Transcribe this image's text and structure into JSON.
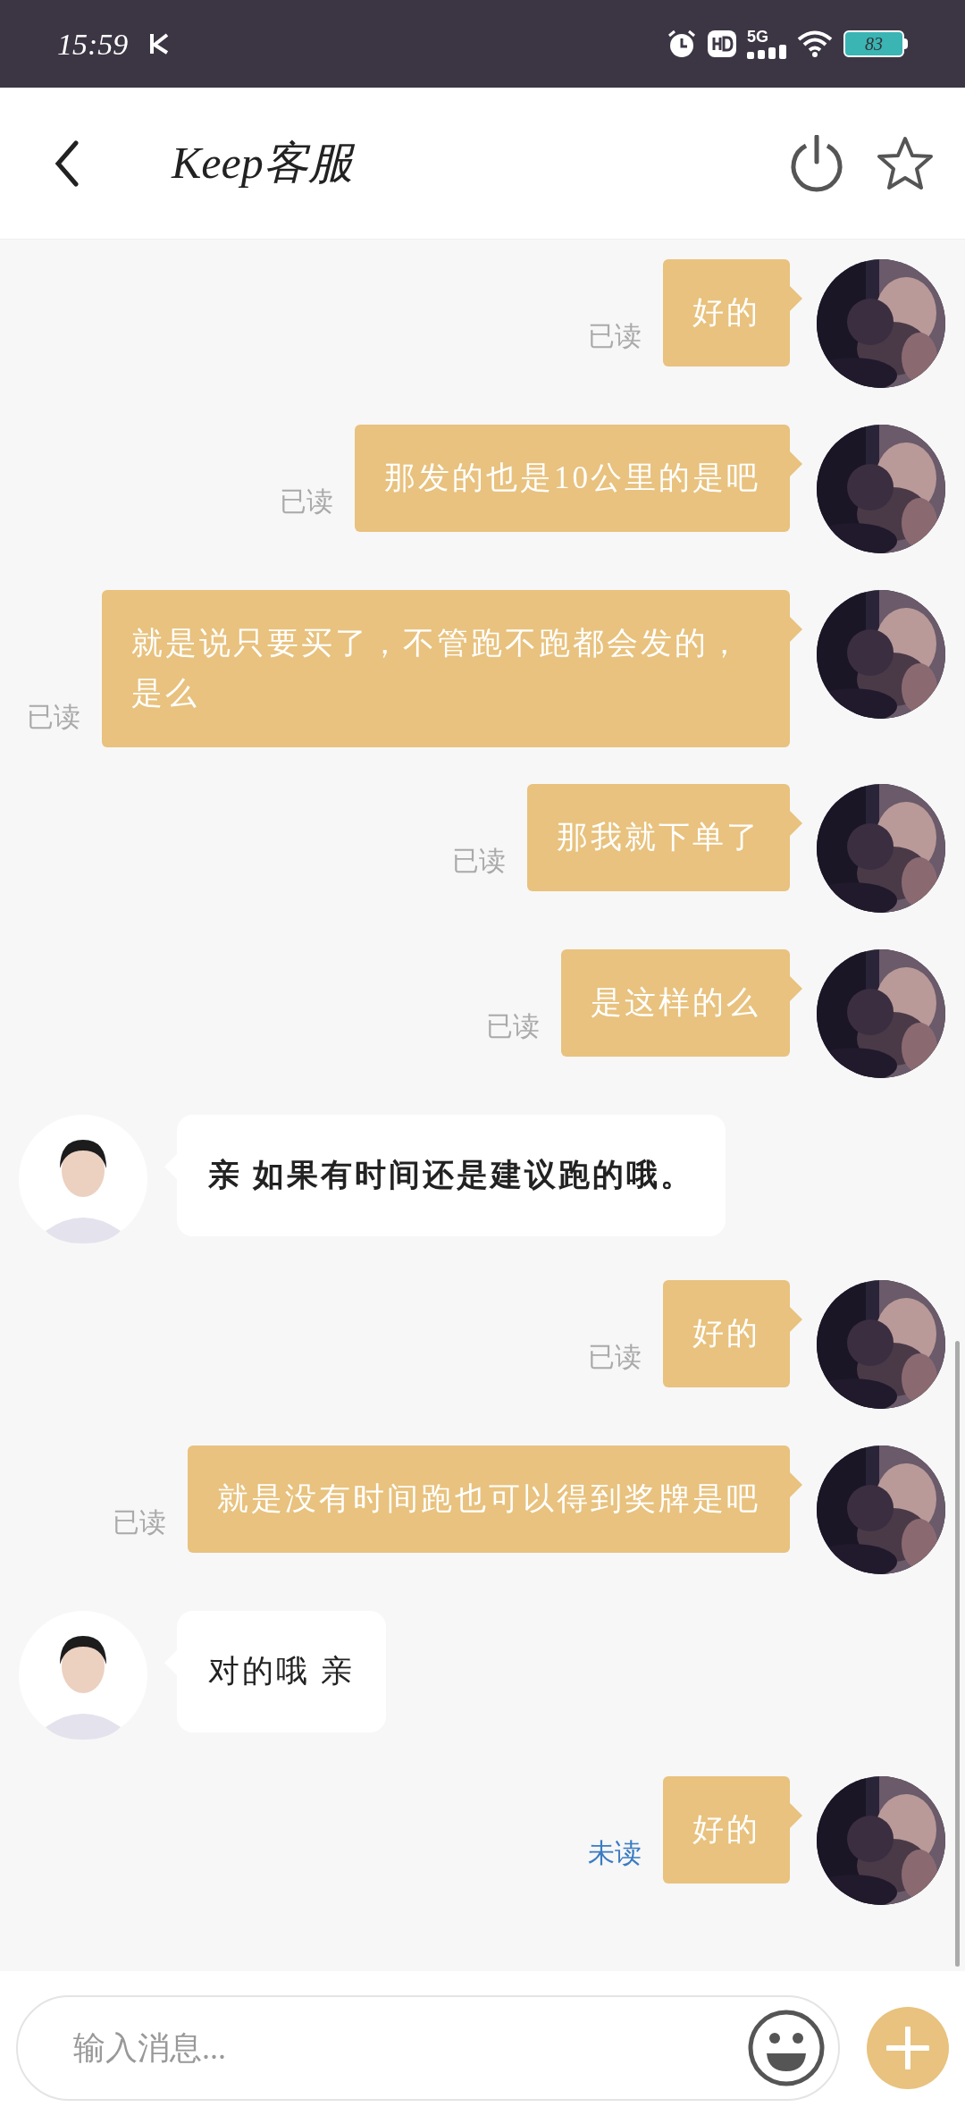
{
  "status_bar": {
    "time": "15:59",
    "network": "5G",
    "battery": "83"
  },
  "header": {
    "title": "Keep客服"
  },
  "messages": [
    {
      "kind": "outgoing",
      "text": "好的",
      "read_label": "已读",
      "read": true
    },
    {
      "kind": "outgoing",
      "text": "那发的也是10公里的是吧",
      "read_label": "已读",
      "read": true
    },
    {
      "kind": "outgoing",
      "text": "就是说只要买了，不管跑不跑都会发的，是么",
      "read_label": "已读",
      "read": true
    },
    {
      "kind": "outgoing",
      "text": "那我就下单了",
      "read_label": "已读",
      "read": true
    },
    {
      "kind": "outgoing",
      "text": "是这样的么",
      "read_label": "已读",
      "read": true
    },
    {
      "kind": "incoming",
      "text": "亲 如果有时间还是建议跑的哦。",
      "bold": true
    },
    {
      "kind": "outgoing",
      "text": "好的",
      "read_label": "已读",
      "read": true
    },
    {
      "kind": "outgoing",
      "text": "就是没有时间跑也可以得到奖牌是吧",
      "read_label": "已读",
      "read": true
    },
    {
      "kind": "incoming",
      "text": "对的哦 亲",
      "bold": false
    },
    {
      "kind": "outgoing",
      "text": "好的",
      "read_label": "未读",
      "read": false
    }
  ],
  "input": {
    "placeholder": "输入消息..."
  }
}
